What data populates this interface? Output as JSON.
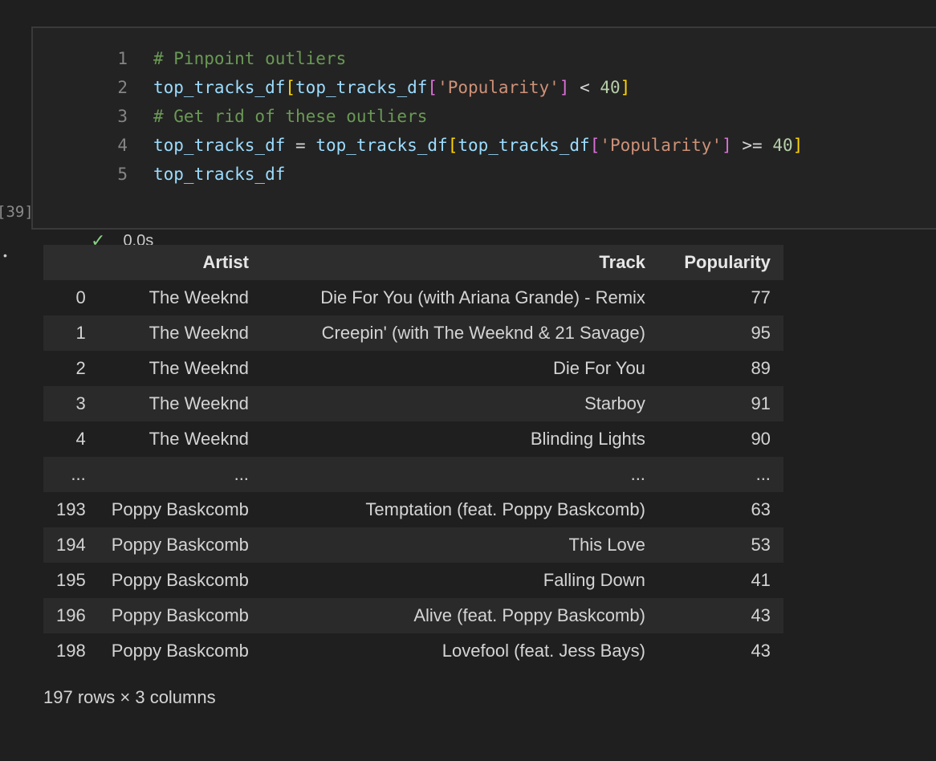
{
  "cell": {
    "execution_count": "[39]",
    "status_icon": "check-icon",
    "duration": "0.0s",
    "lines": [
      {
        "num": "1",
        "parts": [
          {
            "t": "# Pinpoint outliers",
            "c": "cm"
          }
        ]
      },
      {
        "num": "2",
        "parts": [
          {
            "t": "top_tracks_df",
            "c": "v"
          },
          {
            "t": "[",
            "c": "b1"
          },
          {
            "t": "top_tracks_df",
            "c": "v"
          },
          {
            "t": "[",
            "c": "b2"
          },
          {
            "t": "'Popularity'",
            "c": "s"
          },
          {
            "t": "]",
            "c": "b2"
          },
          {
            "t": " < ",
            "c": "op"
          },
          {
            "t": "40",
            "c": "n"
          },
          {
            "t": "]",
            "c": "b1"
          }
        ]
      },
      {
        "num": "3",
        "parts": [
          {
            "t": "# Get rid of these outliers",
            "c": "cm"
          }
        ]
      },
      {
        "num": "4",
        "parts": [
          {
            "t": "top_tracks_df",
            "c": "v"
          },
          {
            "t": " = ",
            "c": "op"
          },
          {
            "t": "top_tracks_df",
            "c": "v"
          },
          {
            "t": "[",
            "c": "b1"
          },
          {
            "t": "top_tracks_df",
            "c": "v"
          },
          {
            "t": "[",
            "c": "b2"
          },
          {
            "t": "'Popularity'",
            "c": "s"
          },
          {
            "t": "]",
            "c": "b2"
          },
          {
            "t": " >= ",
            "c": "op"
          },
          {
            "t": "40",
            "c": "n"
          },
          {
            "t": "]",
            "c": "b1"
          }
        ]
      },
      {
        "num": "5",
        "parts": [
          {
            "t": "top_tracks_df",
            "c": "v"
          }
        ]
      }
    ]
  },
  "output": {
    "columns": [
      "",
      "Artist",
      "Track",
      "Popularity"
    ],
    "rows": [
      [
        "0",
        "The Weeknd",
        "Die For You (with Ariana Grande) - Remix",
        "77"
      ],
      [
        "1",
        "The Weeknd",
        "Creepin' (with The Weeknd & 21 Savage)",
        "95"
      ],
      [
        "2",
        "The Weeknd",
        "Die For You",
        "89"
      ],
      [
        "3",
        "The Weeknd",
        "Starboy",
        "91"
      ],
      [
        "4",
        "The Weeknd",
        "Blinding Lights",
        "90"
      ],
      [
        "...",
        "...",
        "...",
        "..."
      ],
      [
        "193",
        "Poppy Baskcomb",
        "Temptation (feat. Poppy Baskcomb)",
        "63"
      ],
      [
        "194",
        "Poppy Baskcomb",
        "This Love",
        "53"
      ],
      [
        "195",
        "Poppy Baskcomb",
        "Falling Down",
        "41"
      ],
      [
        "196",
        "Poppy Baskcomb",
        "Alive (feat. Poppy Baskcomb)",
        "43"
      ],
      [
        "198",
        "Poppy Baskcomb",
        "Lovefool (feat. Jess Bays)",
        "43"
      ]
    ],
    "shape": "197 rows × 3 columns"
  }
}
